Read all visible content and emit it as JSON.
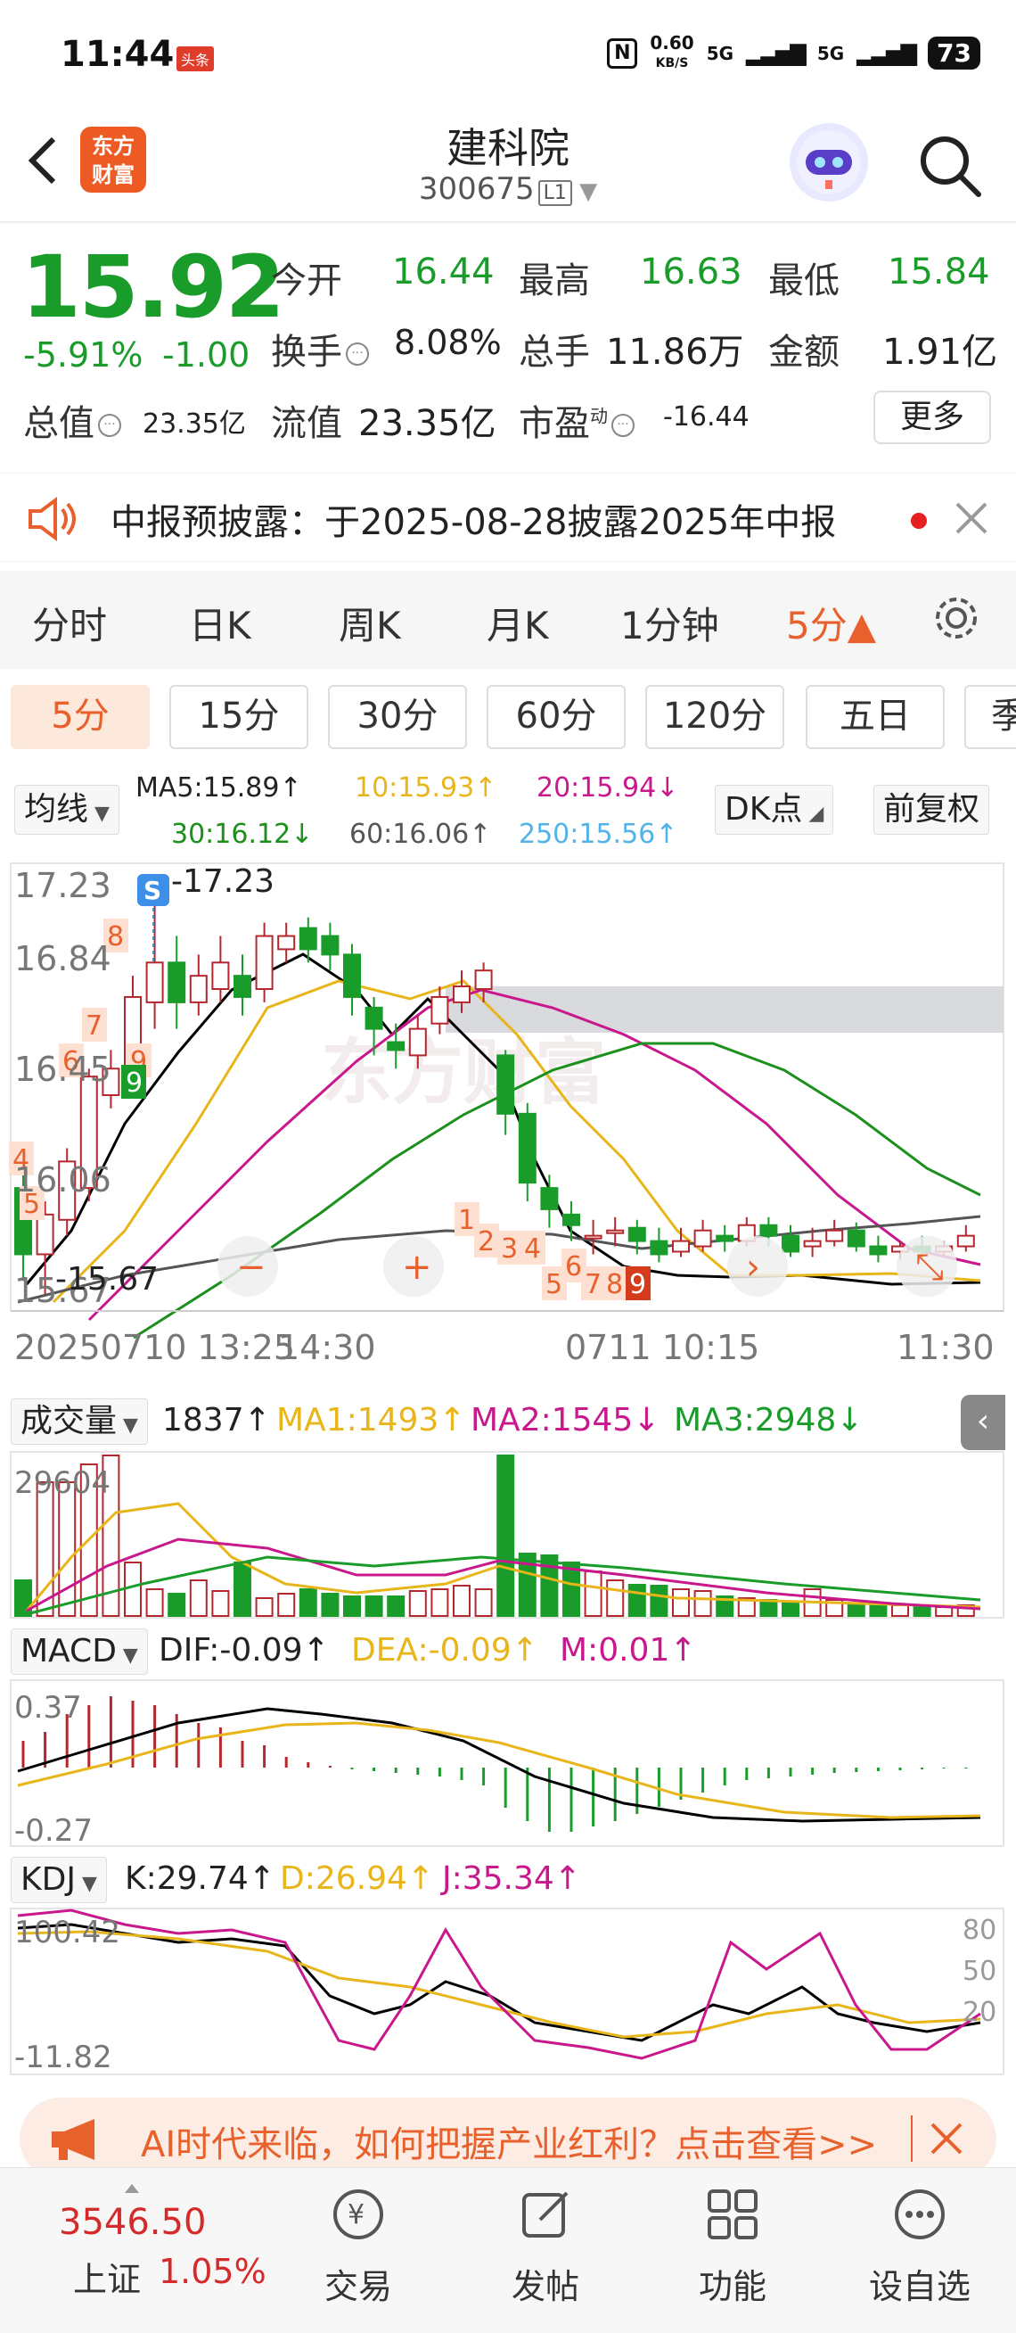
{
  "status_bar": {
    "time": "11:44",
    "badge": "头条",
    "speed_value": "0.60",
    "speed_unit": "KB/S",
    "net1": "5G",
    "net2": "5G",
    "battery": "73"
  },
  "header": {
    "stock_name": "建科院",
    "stock_code": "300675",
    "level": "L1",
    "logo_line1": "东方",
    "logo_line2": "财富"
  },
  "quote": {
    "price": "15.92",
    "change_pct": "-5.91%",
    "change_abs": "-1.00",
    "open_label": "今开",
    "open": "16.44",
    "high_label": "最高",
    "high": "16.63",
    "low_label": "最低",
    "low": "15.84",
    "turnover_label": "换手",
    "turnover": "8.08%",
    "volume_label": "总手",
    "volume": "11.86万",
    "amount_label": "金额",
    "amount": "1.91亿",
    "mktcap_label": "总值",
    "mktcap": "23.35亿",
    "float_label": "流值",
    "float_cap": "23.35亿",
    "pe_label": "市盈",
    "pe_sup": "动",
    "pe": "-16.44",
    "more_label": "更多"
  },
  "notice": {
    "text": "中报预披露：于2025-08-28披露2025年中报"
  },
  "period_tabs": [
    "分时",
    "日K",
    "周K",
    "月K",
    "1分钟",
    "5分▲"
  ],
  "minute_chips": [
    "5分",
    "15分",
    "30分",
    "60分",
    "120分",
    "五日",
    "季"
  ],
  "ma_legend": {
    "type_label": "均线",
    "ma5": "MA5:15.89↑",
    "ma10": "10:15.93↑",
    "ma20": "20:15.94↓",
    "ma30": "30:16.12↓",
    "ma60": "60:16.06↑",
    "ma250": "250:15.56↑",
    "dk_label": "DK点",
    "adjust_label": "前复权"
  },
  "kline": {
    "y_labels": [
      "17.23",
      "16.84",
      "16.45",
      "16.06",
      "15.67"
    ],
    "high_marker": "17.23",
    "low_marker": "15.67",
    "s_marker": "S",
    "x_labels": [
      "20250710 13:25",
      "14:30",
      "0711 10:15",
      "11:30"
    ],
    "seq_labels_left": [
      "4",
      "5",
      "6",
      "7",
      "8",
      "9"
    ],
    "seq_labels_right": [
      "1",
      "2",
      "3",
      "4",
      "5",
      "6",
      "7",
      "8",
      "9"
    ]
  },
  "volume": {
    "type_label": "成交量",
    "value": "1837↑",
    "ma1": "MA1:1493↑",
    "ma2": "MA2:1545↓",
    "ma3": "MA3:2948↓",
    "y_label": "29604"
  },
  "macd": {
    "type_label": "MACD",
    "dif": "DIF:-0.09↑",
    "dea": "DEA:-0.09↑",
    "m": "M:0.01↑",
    "y_top": "0.37",
    "y_bottom": "-0.27"
  },
  "kdj": {
    "type_label": "KDJ",
    "k": "K:29.74↑",
    "d": "D:26.94↑",
    "j": "J:35.34↑",
    "y_top": "100.42",
    "y_bottom": "-11.82",
    "r80": "80",
    "r50": "50",
    "r20": "20"
  },
  "banner": {
    "text": "AI时代来临，如何把握产业红利？点击查看>>"
  },
  "bottom_nav": {
    "index_value": "3546.50",
    "index_name": "上证",
    "index_change": "1.05%",
    "items": [
      "交易",
      "发帖",
      "功能",
      "设自选"
    ]
  },
  "colors": {
    "up": "#b3272d",
    "down": "#1a9c2b",
    "accent": "#e8612c",
    "ma5": "#000000",
    "ma10": "#e8b51a",
    "ma20": "#c8188c",
    "ma30": "#1d8f1d",
    "ma60": "#555555",
    "ma250": "#52b3e8"
  }
}
